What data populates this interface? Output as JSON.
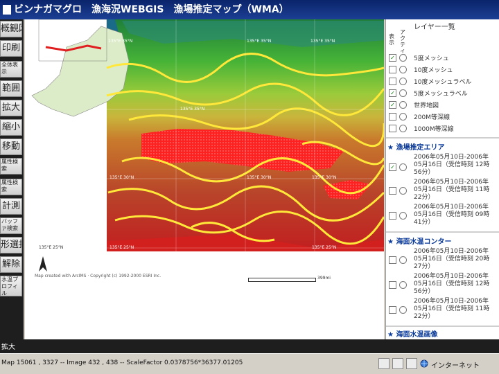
{
  "window": {
    "title": "ビンナガマグロ　漁海況WEBGIS　漁場推定マップ（WMA）"
  },
  "toolbar": {
    "buttons": [
      {
        "label": "概観図"
      },
      {
        "label": "印刷"
      },
      {
        "label": "全体表示"
      },
      {
        "label": "範囲"
      },
      {
        "label": "拡大"
      },
      {
        "label": "縮小"
      },
      {
        "label": "移動"
      },
      {
        "label": "属性検索"
      },
      {
        "label": "属性検索"
      },
      {
        "label": "計測"
      },
      {
        "label": "バッファ検索"
      },
      {
        "label": "形選択"
      },
      {
        "label": "解除"
      },
      {
        "label": "水温プロフィル"
      }
    ]
  },
  "map": {
    "coord_labels": [
      "135°E 35°N",
      "135°E 35°N",
      "135°E 35°N",
      "135°E 30°N",
      "135°E 30°N",
      "135°E 30°N",
      "135°E 30°N",
      "135°E 25°N",
      "135°E 25°N",
      "135°E 25°N",
      "135°E 35°N"
    ],
    "copyright": "Map created with ArcIMS · Copyright (c) 1992-2000 ESRI Inc.",
    "scale_label": "399mi"
  },
  "layers_panel": {
    "title": "レイヤー一覧",
    "col_display": "表示",
    "col_active": "アクティブ",
    "layers": [
      {
        "label": "5度メッシュ",
        "checked": true
      },
      {
        "label": "10度メッシュ",
        "checked": false
      },
      {
        "label": "10度メッシュラベル",
        "checked": false
      },
      {
        "label": "5度メッシュラベル",
        "checked": true
      },
      {
        "label": "世界地図",
        "checked": true
      },
      {
        "label": "200M等深線",
        "checked": false
      },
      {
        "label": "1000M等深線",
        "checked": false
      }
    ],
    "sections": [
      {
        "title": "漁場推定エリア",
        "items": [
          {
            "label": "2006年05月10日-2006年05月16日（受信時刻 12時56分）",
            "checked": true
          },
          {
            "label": "2006年05月10日-2006年05月16日（受信時刻 11時22分）",
            "checked": false
          },
          {
            "label": "2006年05月10日-2006年05月16日（受信時刻 09時41分）",
            "checked": false
          }
        ]
      },
      {
        "title": "海面水温コンター",
        "items": [
          {
            "label": "2006年05月10日-2006年05月16日（受信時刻 20時27分）",
            "checked": false
          },
          {
            "label": "2006年05月10日-2006年05月16日（受信時刻 12時56分）",
            "checked": false
          },
          {
            "label": "2006年05月10日-2006年05月16日（受信時刻 11時22分）",
            "checked": false
          }
        ]
      },
      {
        "title": "海面水温画像",
        "items": []
      }
    ]
  },
  "bottom_label": "拡大",
  "statusbar": {
    "text": "Map 15061 , 3327 -- Image 432 , 438 -- ScaleFactor 0.0378756*36377.01205",
    "zone": "インターネット"
  },
  "colors": {
    "titlebar": "#0a246a",
    "contour": "#ffe83a",
    "fishing_area": "#ff1a1a",
    "accent": "#0a3a9a"
  }
}
